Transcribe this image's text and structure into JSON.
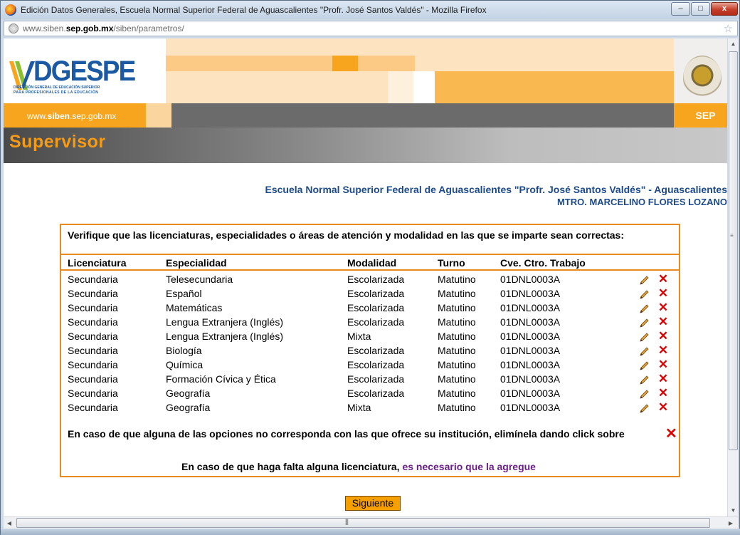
{
  "window": {
    "title": "Edición Datos Generales, Escuela Normal Superior Federal de Aguascalientes \"Profr. José Santos Valdés\" - Mozilla Firefox",
    "minimize": "–",
    "maximize": "□",
    "close": "x"
  },
  "address_bar": {
    "url_prefix": "www.siben.",
    "url_domain": "sep.gob.mx",
    "url_path": "/siben/parametros/"
  },
  "header": {
    "logo_text": "DGESPE",
    "logo_sub1": "DIRECCIÓN GENERAL DE EDUCACIÓN SUPERIOR",
    "logo_sub2": "PARA PROFESIONALES DE LA EDUCACIÓN",
    "site_link_prefix": "www.",
    "site_link_bold": "siben",
    "site_link_suffix": ".sep.gob.mx",
    "sep_label": "SEP",
    "section_title": "Supervisor"
  },
  "school": {
    "name": "Escuela Normal Superior Federal de Aguascalientes \"Profr. José Santos Valdés\" - Aguascalientes",
    "director": "MTRO. MARCELINO FLORES LOZANO"
  },
  "panel": {
    "instruction": "Verifique que las licenciaturas, especialidades o áreas de atención y modalidad en las que se imparte sean correctas:",
    "columns": {
      "licenciatura": "Licenciatura",
      "especialidad": "Especialidad",
      "modalidad": "Modalidad",
      "turno": "Turno",
      "cve": "Cve. Ctro. Trabajo"
    },
    "rows": [
      {
        "licenciatura": "Secundaria",
        "especialidad": "Telesecundaria",
        "modalidad": "Escolarizada",
        "turno": "Matutino",
        "cve": "01DNL0003A"
      },
      {
        "licenciatura": "Secundaria",
        "especialidad": "Español",
        "modalidad": "Escolarizada",
        "turno": "Matutino",
        "cve": "01DNL0003A"
      },
      {
        "licenciatura": "Secundaria",
        "especialidad": "Matemáticas",
        "modalidad": "Escolarizada",
        "turno": "Matutino",
        "cve": "01DNL0003A"
      },
      {
        "licenciatura": "Secundaria",
        "especialidad": "Lengua Extranjera (Inglés)",
        "modalidad": "Escolarizada",
        "turno": "Matutino",
        "cve": "01DNL0003A"
      },
      {
        "licenciatura": "Secundaria",
        "especialidad": "Lengua Extranjera (Inglés)",
        "modalidad": "Mixta",
        "turno": "Matutino",
        "cve": "01DNL0003A"
      },
      {
        "licenciatura": "Secundaria",
        "especialidad": "Biología",
        "modalidad": "Escolarizada",
        "turno": "Matutino",
        "cve": "01DNL0003A"
      },
      {
        "licenciatura": "Secundaria",
        "especialidad": "Química",
        "modalidad": "Escolarizada",
        "turno": "Matutino",
        "cve": "01DNL0003A"
      },
      {
        "licenciatura": "Secundaria",
        "especialidad": "Formación Cívica y Ética",
        "modalidad": "Escolarizada",
        "turno": "Matutino",
        "cve": "01DNL0003A"
      },
      {
        "licenciatura": "Secundaria",
        "especialidad": "Geografía",
        "modalidad": "Escolarizada",
        "turno": "Matutino",
        "cve": "01DNL0003A"
      },
      {
        "licenciatura": "Secundaria",
        "especialidad": "Geografía",
        "modalidad": "Mixta",
        "turno": "Matutino",
        "cve": "01DNL0003A"
      }
    ],
    "note_delete": "En caso de que alguna de las opciones no corresponda con las que ofrece su institución, elimínela dando click sobre",
    "note_add_prefix": "En caso de que haga falta alguna licenciatura, ",
    "note_add_link": "es necesario que la agregue"
  },
  "buttons": {
    "next": "Siguiente"
  },
  "icons": {
    "edit": "pencil-icon",
    "delete": "red-x-icon"
  },
  "colors": {
    "accent_orange": "#f7a51e",
    "title_blue": "#1c4a8c",
    "panel_border": "#e98a1c",
    "delete_red": "#e00000",
    "link_purple": "#6a1d86"
  }
}
